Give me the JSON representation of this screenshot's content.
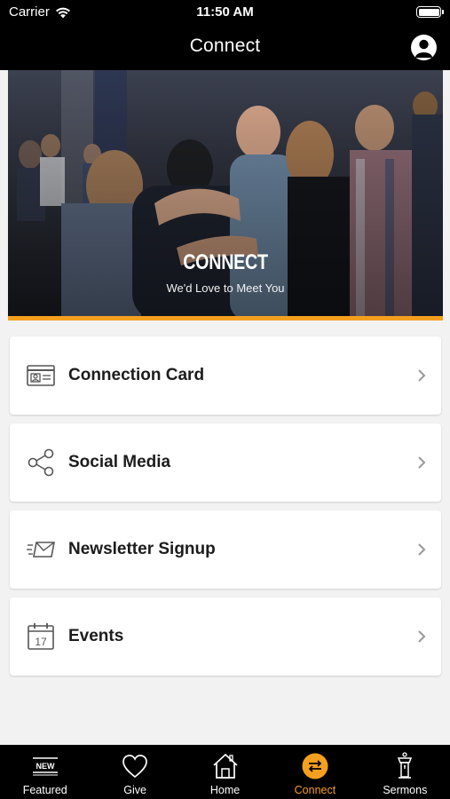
{
  "status_bar": {
    "carrier": "Carrier",
    "time": "11:50 AM"
  },
  "nav": {
    "title": "Connect"
  },
  "hero": {
    "title": "CONNECT",
    "subtitle": "We'd Love to Meet You"
  },
  "menu": [
    {
      "label": "Connection Card",
      "icon": "contact-card-icon"
    },
    {
      "label": "Social Media",
      "icon": "share-icon"
    },
    {
      "label": "Newsletter Signup",
      "icon": "envelope-icon"
    },
    {
      "label": "Events",
      "icon": "calendar-icon",
      "icon_text": "17"
    }
  ],
  "tabs": [
    {
      "label": "Featured",
      "icon": "featured-new-icon",
      "icon_text": "NEW"
    },
    {
      "label": "Give",
      "icon": "heart-icon"
    },
    {
      "label": "Home",
      "icon": "home-icon"
    },
    {
      "label": "Connect",
      "icon": "connect-arrows-icon",
      "active": true
    },
    {
      "label": "Sermons",
      "icon": "pulpit-icon"
    }
  ],
  "colors": {
    "accent": "#f4a01e",
    "bar": "#000000",
    "background": "#f2f2f2"
  }
}
